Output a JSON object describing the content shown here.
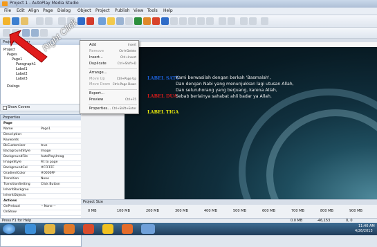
{
  "window": {
    "title": "Project 1 - AutoPlay Media Studio"
  },
  "menu": [
    "File",
    "Edit",
    "Align",
    "Page",
    "Dialog",
    "Object",
    "Project",
    "Publish",
    "View",
    "Tools",
    "Help"
  ],
  "project_panel": {
    "title": "Project Explorer",
    "items": [
      "Project",
      "Pages",
      "Page1",
      "Paragraph1",
      "Label1",
      "Label2",
      "Label3",
      "Dialogs"
    ]
  },
  "show_covers": "Show Covers",
  "properties": {
    "title": "Properties",
    "rows": [
      {
        "k": "Page",
        "v": ""
      },
      {
        "k": "Name",
        "v": "Page1"
      },
      {
        "k": "Description",
        "v": ""
      },
      {
        "k": "Keywords",
        "v": ""
      },
      {
        "k": "BkCustomizer",
        "v": "true"
      },
      {
        "k": "BackgroundStyle",
        "v": "Image"
      },
      {
        "k": "BackgroundFile",
        "v": "AutoPlay\\Imag"
      },
      {
        "k": "ImageStyle",
        "v": "Fit to page"
      },
      {
        "k": "BackgroundCol",
        "v": "#FFFFFF"
      },
      {
        "k": "GradientColor",
        "v": "#0000FF"
      },
      {
        "k": "Transition",
        "v": "None"
      },
      {
        "k": "TransitionSetting",
        "v": "Click Button"
      },
      {
        "k": "InheritBackgrou",
        "v": ""
      },
      {
        "k": "InheritObjects",
        "v": ""
      },
      {
        "k": "Actions",
        "v": ""
      },
      {
        "k": "OnPreload",
        "v": "-- None --"
      },
      {
        "k": "OnShow",
        "v": ""
      }
    ]
  },
  "context_menu": {
    "items": [
      {
        "label": "Add",
        "shortcut": "Insert",
        "enabled": true
      },
      {
        "label": "Remove",
        "shortcut": "Ctrl+Delete",
        "enabled": false
      },
      {
        "label": "Insert...",
        "shortcut": "Ctrl+Insert",
        "enabled": true
      },
      {
        "label": "Duplicate",
        "shortcut": "Ctrl+Shift+D",
        "enabled": true
      },
      {
        "label": "Arrange...",
        "shortcut": "",
        "enabled": true
      },
      {
        "label": "Move Up",
        "shortcut": "Ctrl+Page Up",
        "enabled": false
      },
      {
        "label": "Move Down",
        "shortcut": "Ctrl+Page Down",
        "enabled": false
      },
      {
        "label": "Export...",
        "shortcut": "",
        "enabled": true
      },
      {
        "label": "Preview",
        "shortcut": "Ctrl+F5",
        "enabled": true
      },
      {
        "label": "Properties...",
        "shortcut": "Ctrl+Shift+Enter",
        "enabled": true
      }
    ]
  },
  "canvas": {
    "labels": [
      {
        "text": "LABEL SATU",
        "color": "#1c5fd6"
      },
      {
        "text": "LABEL DUA",
        "color": "#d11b1b"
      },
      {
        "text": "LABEL TIGA",
        "color": "#e8e80c"
      }
    ],
    "paragraph": [
      "Kami berwasilah dengan berkah 'Basmalah',",
      "Dan dengan Nabi yang menunjukkan lagi utusan Allah,",
      "Dan seluruhorang yang berjuang, karena Allah,",
      "Sebab berlainya sahabat ahli badar ya Allah."
    ]
  },
  "project_size": "Project Size",
  "timeline": [
    "0 MB",
    "100 MB",
    "200 MB",
    "300 MB",
    "400 MB",
    "500 MB",
    "600 MB",
    "700 MB",
    "800 MB",
    "900 MB"
  ],
  "status": {
    "left": "Press F1 for Help",
    "mem": "0.0 MB",
    "coords": "-46,153",
    "size": "0, 0"
  },
  "annotation": {
    "text": "Right Click"
  },
  "tray": {
    "time": "11:40 AM",
    "date": "4/26/2013"
  },
  "colors": {
    "accent": "#2b73c2",
    "arrow": "#e01b1b"
  }
}
